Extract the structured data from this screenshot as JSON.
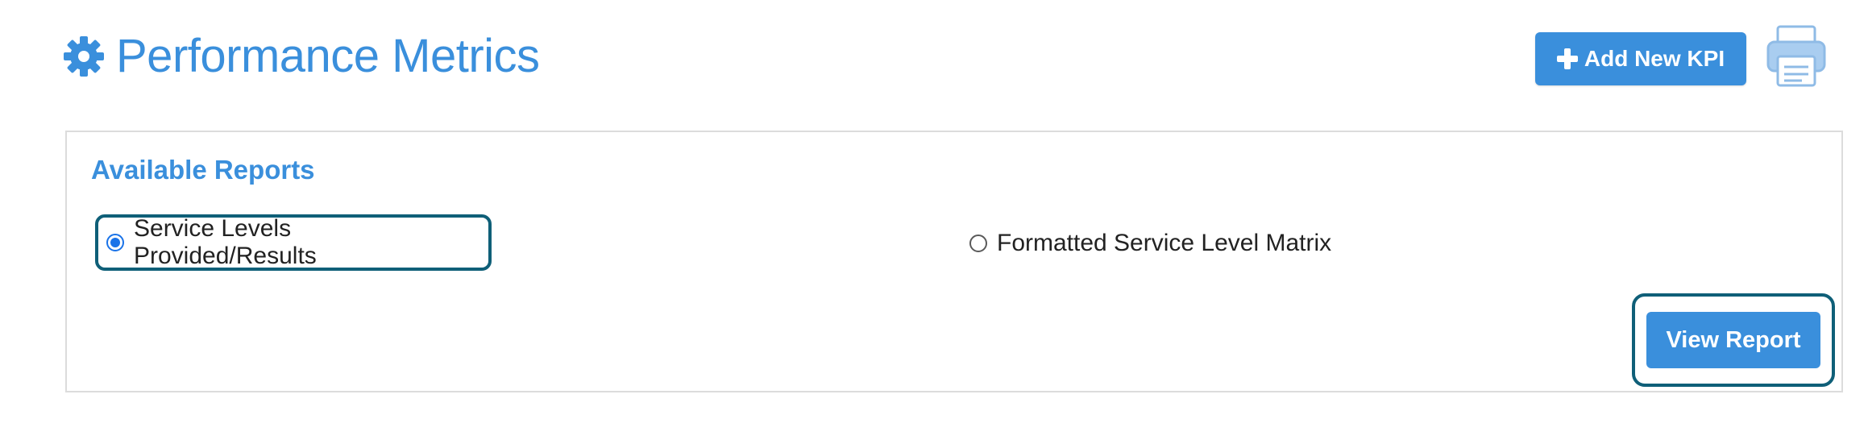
{
  "header": {
    "title": "Performance Metrics",
    "title_icon": "gear-icon",
    "add_kpi_label": "Add New KPI",
    "add_kpi_icon": "plus-icon",
    "print_icon": "printer-icon"
  },
  "reports": {
    "heading": "Available Reports",
    "options": [
      {
        "label": "Service Levels Provided/Results",
        "selected": true
      },
      {
        "label": "Formatted Service Level Matrix",
        "selected": false
      }
    ],
    "view_report_label": "View Report"
  },
  "colors": {
    "accent": "#3a8fdc",
    "focus_ring": "#0f5f78",
    "panel_border": "#dcdcdc",
    "radio_checked": "#1a73e8"
  }
}
